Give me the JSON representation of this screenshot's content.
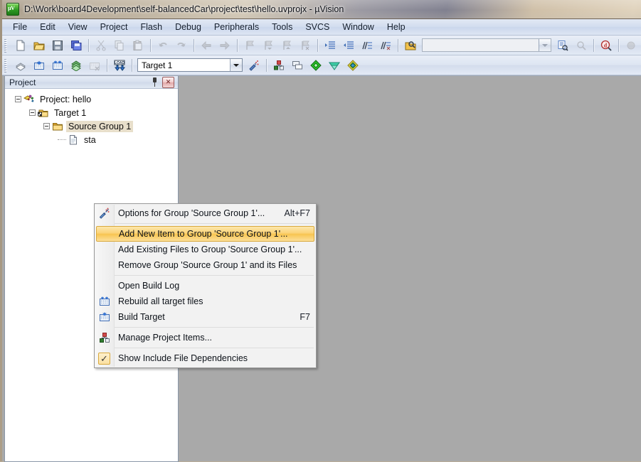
{
  "window": {
    "title": "D:\\Work\\board4Development\\self-balancedCar\\project\\test\\hello.uvprojx - µVision",
    "app_icon": "uvision-logo-icon"
  },
  "menubar": {
    "items": [
      {
        "label": "File"
      },
      {
        "label": "Edit"
      },
      {
        "label": "View"
      },
      {
        "label": "Project"
      },
      {
        "label": "Flash"
      },
      {
        "label": "Debug"
      },
      {
        "label": "Peripherals"
      },
      {
        "label": "Tools"
      },
      {
        "label": "SVCS"
      },
      {
        "label": "Window"
      },
      {
        "label": "Help"
      }
    ]
  },
  "toolbar_main": {
    "buttons": [
      {
        "name": "new-file-icon",
        "enabled": true
      },
      {
        "name": "open-file-icon",
        "enabled": true
      },
      {
        "name": "save-icon",
        "enabled": true
      },
      {
        "name": "save-all-icon",
        "enabled": true
      },
      {
        "name": "cut-icon",
        "enabled": false
      },
      {
        "name": "copy-icon",
        "enabled": false
      },
      {
        "name": "paste-icon",
        "enabled": false
      },
      {
        "name": "undo-icon",
        "enabled": false
      },
      {
        "name": "redo-icon",
        "enabled": false
      },
      {
        "name": "navigate-back-icon",
        "enabled": false
      },
      {
        "name": "navigate-forward-icon",
        "enabled": false
      },
      {
        "name": "bookmark-toggle-icon",
        "enabled": false
      },
      {
        "name": "bookmark-prev-icon",
        "enabled": false
      },
      {
        "name": "bookmark-next-icon",
        "enabled": false
      },
      {
        "name": "bookmark-clear-icon",
        "enabled": false
      },
      {
        "name": "indent-icon",
        "enabled": true
      },
      {
        "name": "outdent-icon",
        "enabled": true
      },
      {
        "name": "comment-icon",
        "enabled": true
      },
      {
        "name": "uncomment-icon",
        "enabled": true
      },
      {
        "name": "find-in-files-icon",
        "enabled": true
      }
    ],
    "find_box": {
      "value": "",
      "placeholder": ""
    },
    "right_buttons": [
      {
        "name": "find-icon",
        "enabled": true
      },
      {
        "name": "incremental-find-icon",
        "enabled": false
      },
      {
        "name": "debug-session-icon",
        "enabled": true
      },
      {
        "name": "breakpoint-disabled-icon",
        "enabled": false
      },
      {
        "name": "breakpoint-icon",
        "enabled": false
      },
      {
        "name": "disable-all-breakpoints-icon",
        "enabled": true
      },
      {
        "name": "kill-all-breakpoints-icon",
        "enabled": true
      },
      {
        "name": "project-window-icon",
        "enabled": true
      }
    ]
  },
  "toolbar_build": {
    "buttons": [
      {
        "name": "translate-file-icon",
        "enabled": true
      },
      {
        "name": "build-target-icon",
        "enabled": true
      },
      {
        "name": "rebuild-all-icon",
        "enabled": true
      },
      {
        "name": "batch-build-icon",
        "enabled": true
      },
      {
        "name": "stop-build-icon",
        "enabled": false
      },
      {
        "name": "download-to-flash-icon",
        "enabled": true
      }
    ],
    "target_select": {
      "value": "Target 1"
    },
    "after_buttons": [
      {
        "name": "target-options-icon",
        "enabled": true
      },
      {
        "name": "manage-project-items-icon",
        "enabled": true
      },
      {
        "name": "multi-project-icon",
        "enabled": true
      },
      {
        "name": "pack-installer-icon",
        "enabled": true
      },
      {
        "name": "manage-run-time-env-icon",
        "enabled": true
      },
      {
        "name": "select-software-packs-icon",
        "enabled": true
      }
    ]
  },
  "project_panel": {
    "title": "Project",
    "pin_icon": "pin-icon",
    "close_icon": "close-icon",
    "tree": [
      {
        "label": "Project: hello",
        "icon": "project-icon",
        "depth": 0,
        "expanded": true,
        "selected": false
      },
      {
        "label": "Target 1",
        "icon": "target-folder-icon",
        "depth": 1,
        "expanded": true,
        "selected": false
      },
      {
        "label": "Source Group 1",
        "icon": "folder-icon",
        "depth": 2,
        "expanded": true,
        "selected": true
      },
      {
        "label": "sta",
        "icon": "file-icon",
        "depth": 3,
        "expanded": null,
        "selected": false
      }
    ]
  },
  "context_menu": {
    "items": [
      {
        "label": "Options for Group 'Source Group 1'...",
        "accel": "Alt+F7",
        "icon": "options-wand-icon",
        "highlighted": false,
        "checked": false
      },
      {
        "separator": true
      },
      {
        "label": "Add New  Item to Group 'Source Group 1'...",
        "accel": "",
        "icon": "",
        "highlighted": true,
        "checked": false
      },
      {
        "label": "Add Existing Files to Group 'Source Group 1'...",
        "accel": "",
        "icon": "",
        "highlighted": false,
        "checked": false
      },
      {
        "label": "Remove Group 'Source Group 1' and its Files",
        "accel": "",
        "icon": "",
        "highlighted": false,
        "checked": false
      },
      {
        "separator": true
      },
      {
        "label": "Open Build Log",
        "accel": "",
        "icon": "",
        "highlighted": false,
        "checked": false
      },
      {
        "label": "Rebuild all target files",
        "accel": "",
        "icon": "rebuild-all-icon",
        "highlighted": false,
        "checked": false
      },
      {
        "label": "Build Target",
        "accel": "F7",
        "icon": "build-target-icon",
        "highlighted": false,
        "checked": false
      },
      {
        "separator": true
      },
      {
        "label": "Manage Project Items...",
        "accel": "",
        "icon": "manage-project-items-icon",
        "highlighted": false,
        "checked": false
      },
      {
        "separator": true
      },
      {
        "label": "Show Include File Dependencies",
        "accel": "",
        "icon": "checkmark-icon",
        "highlighted": false,
        "checked": true
      }
    ]
  },
  "colors": {
    "highlight_orange": "#f8c550",
    "selection_tan": "#e8dfcb",
    "mdi_background": "#a9a9a9",
    "toolbar_blue": "#dde5f2"
  }
}
